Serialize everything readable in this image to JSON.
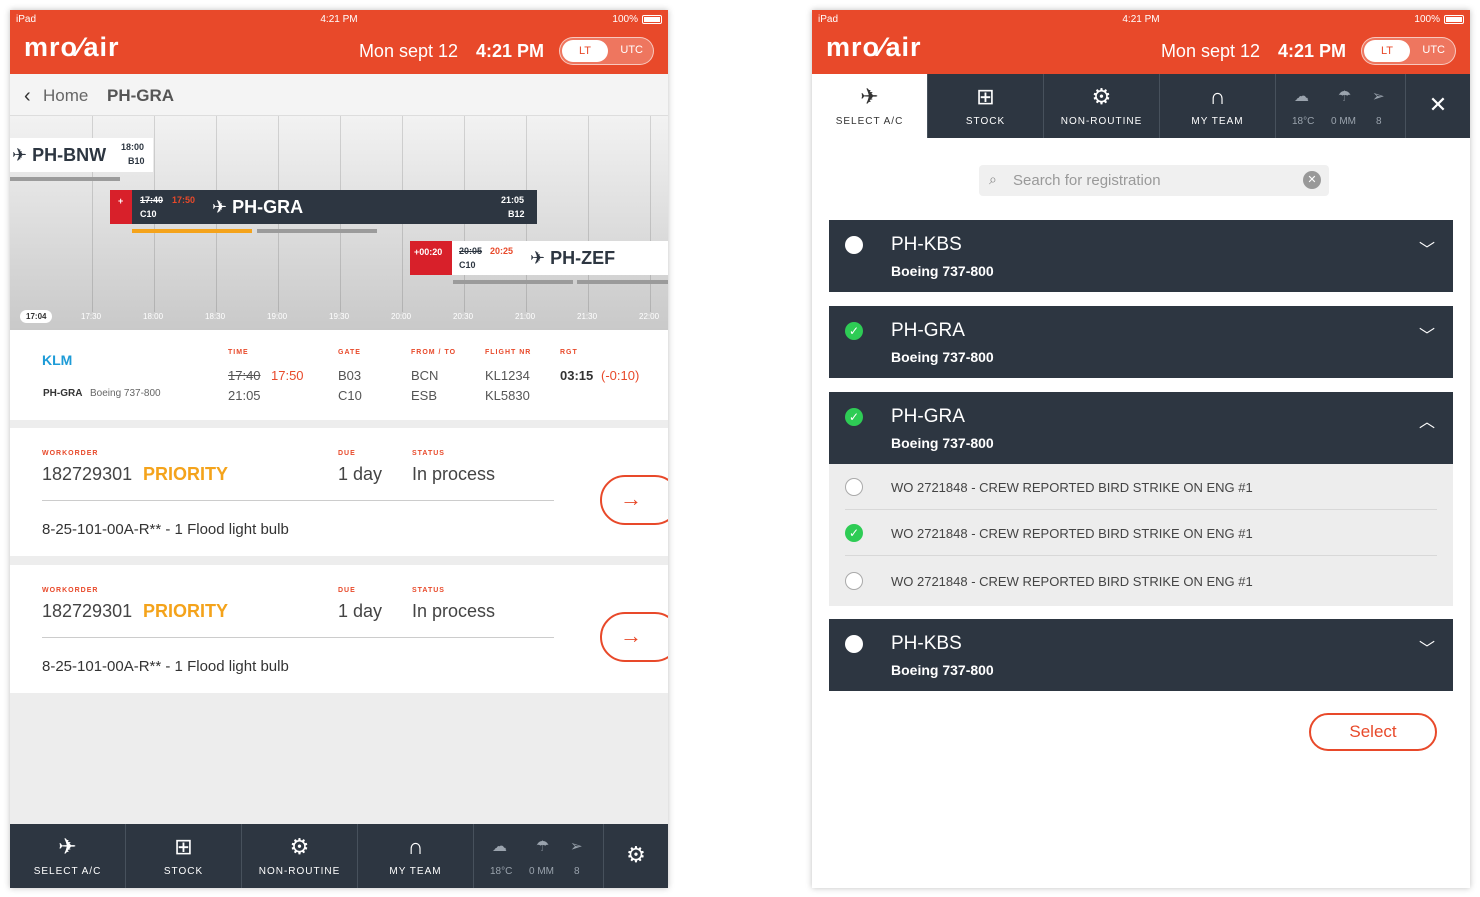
{
  "status": {
    "device": "iPad",
    "time": "4:21 PM",
    "battery": "100%"
  },
  "header": {
    "logo": "mro⁄air",
    "date": "Mon sept 12",
    "time": "4:21 PM",
    "toggle_on": "LT",
    "toggle_off": "UTC"
  },
  "breadcrumb": {
    "back": "Home",
    "current": "PH-GRA"
  },
  "timeline": {
    "now": "17:04",
    "ticks": [
      "17:30",
      "18:00",
      "18:30",
      "19:00",
      "19:30",
      "20:00",
      "20:30",
      "21:00",
      "21:30",
      "22:00"
    ],
    "flights": [
      {
        "reg": "PH-BNW",
        "time": "18:00",
        "gate": "B10"
      },
      {
        "reg": "PH-GRA",
        "delay": "+",
        "sched": "17:40",
        "actual": "17:50",
        "gate_in": "C10",
        "dep": "21:05",
        "gate_out": "B12"
      },
      {
        "reg": "PH-ZEF",
        "delay": "+00:20",
        "sched": "20:05",
        "actual": "20:25",
        "gate_in": "C10"
      }
    ]
  },
  "flight_info": {
    "airline": "KLM",
    "reg": "PH-GRA",
    "type": "Boeing 737-800",
    "time_label": "TIME",
    "time_sched": "17:40",
    "time_actual": "17:50",
    "time_dep": "21:05",
    "gate_label": "GATE",
    "gate_in": "B03",
    "gate_out": "C10",
    "fromto_label": "FROM / TO",
    "from": "BCN",
    "to": "ESB",
    "flightnr_label": "FLIGHT NR",
    "fn_in": "KL1234",
    "fn_out": "KL5830",
    "rgt_label": "RGT",
    "rgt": "03:15",
    "rgt_delta": "(-0:10)"
  },
  "workorders": [
    {
      "label": "WORKORDER",
      "number": "182729301",
      "priority": "PRIORITY",
      "due_label": "DUE",
      "due": "1 day",
      "status_label": "STATUS",
      "status": "In process",
      "desc": "8-25-101-00A-R** - 1 Flood light bulb"
    },
    {
      "label": "WORKORDER",
      "number": "182729301",
      "priority": "PRIORITY",
      "due_label": "DUE",
      "due": "1 day",
      "status_label": "STATUS",
      "status": "In process",
      "desc": "8-25-101-00A-R** - 1 Flood light bulb"
    }
  ],
  "nav": {
    "select": "SELECT A/C",
    "stock": "STOCK",
    "nonroutine": "NON-ROUTINE",
    "team": "MY TEAM",
    "temp": "18°C",
    "rain": "0 MM",
    "wind": "8"
  },
  "search": {
    "placeholder": "Search for registration"
  },
  "aircraft": [
    {
      "reg": "PH-KBS",
      "type": "Boeing 737-800",
      "selected": false
    },
    {
      "reg": "PH-GRA",
      "type": "Boeing 737-800",
      "selected": true
    },
    {
      "reg": "PH-GRA",
      "type": "Boeing 737-800",
      "selected": true,
      "expanded": true
    },
    {
      "reg": "PH-KBS",
      "type": "Boeing 737-800",
      "selected": false
    }
  ],
  "subitems": [
    {
      "text": "WO 2721848 - CREW REPORTED BIRD STRIKE ON ENG #1",
      "checked": false
    },
    {
      "text": "WO 2721848 - CREW REPORTED BIRD STRIKE ON ENG #1",
      "checked": true
    },
    {
      "text": "WO 2721848 - CREW REPORTED BIRD STRIKE ON ENG #1",
      "checked": false
    }
  ],
  "select_button": "Select",
  "colors": {
    "brand": "#e8492a",
    "dark": "#2d3641",
    "priority": "#f4a31b",
    "check": "#2ecc55"
  }
}
